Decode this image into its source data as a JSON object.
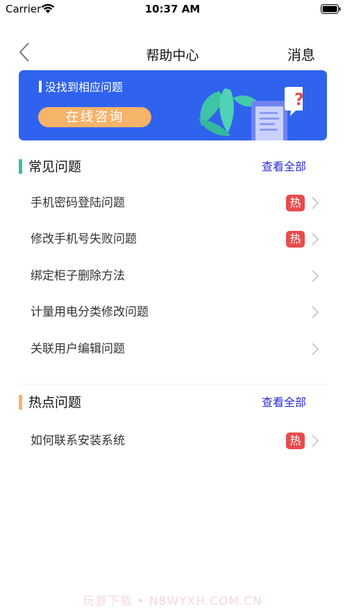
{
  "status_bar": {
    "carrier": "Carrier",
    "time": "10:37 AM",
    "icons": [
      "wifi-icon",
      "battery-icon"
    ]
  },
  "nav": {
    "back_icon": "chevron-left-icon",
    "title": "帮助中心",
    "right_label": "消息"
  },
  "banner": {
    "title": "没找到相应问题",
    "button_label": "在线咨询",
    "colors": {
      "background": "#2f63ee",
      "button": "#f6b36a"
    },
    "illustration": "phone-question-icon"
  },
  "sections": [
    {
      "title": "常见问题",
      "accent_color": "#3cbfa0",
      "view_all_label": "查看全部",
      "items": [
        {
          "label": "手机密码登陆问题",
          "badge": "热"
        },
        {
          "label": "修改手机号失败问题",
          "badge": "热"
        },
        {
          "label": "绑定柜子删除方法",
          "badge": ""
        },
        {
          "label": "计量用电分类修改问题",
          "badge": ""
        },
        {
          "label": "关联用户编辑问题",
          "badge": ""
        }
      ]
    },
    {
      "title": "热点问题",
      "accent_color": "#f6b36a",
      "view_all_label": "查看全部",
      "items": [
        {
          "label": "如何联系安装系统",
          "badge": "热"
        }
      ]
    }
  ],
  "colors": {
    "hot_badge": "#e94b4b",
    "link": "#2b2bd8"
  },
  "watermark": "玩意下载 • N8WYXH.COM.CN"
}
